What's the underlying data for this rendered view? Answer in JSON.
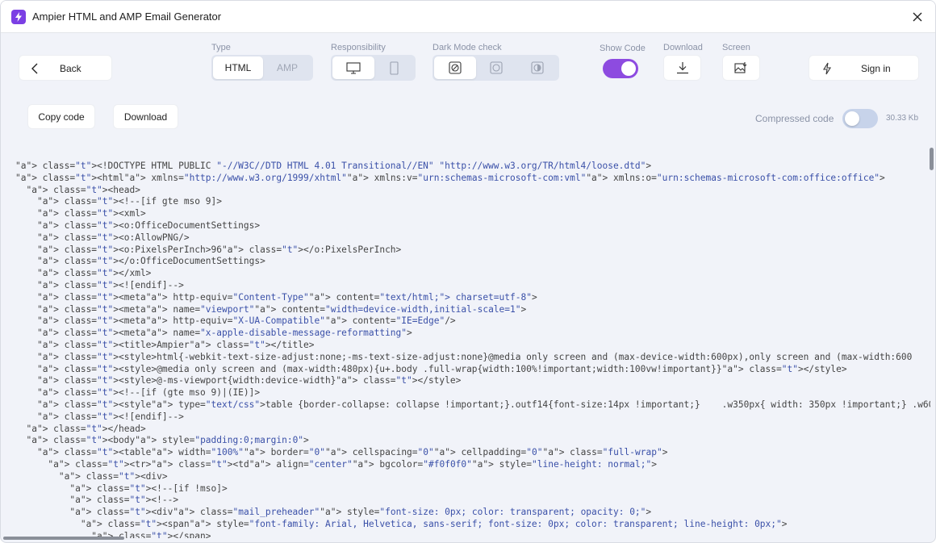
{
  "window": {
    "title": "Ampier HTML and AMP Email Generator"
  },
  "toolbar": {
    "back_label": "Back",
    "type": {
      "label": "Type",
      "options": [
        "HTML",
        "AMP"
      ],
      "selected": "HTML"
    },
    "responsibility": {
      "label": "Responsibility",
      "selected": "desktop"
    },
    "dark_mode": {
      "label": "Dark Mode check",
      "selected": "auto"
    },
    "show_code": {
      "label": "Show Code",
      "on": true
    },
    "download": {
      "label": "Download"
    },
    "screen": {
      "label": "Screen"
    },
    "sign_in_label": "Sign in"
  },
  "actions": {
    "copy_code_label": "Copy code",
    "download_label": "Download",
    "compressed_label": "Compressed code",
    "compressed_on": false,
    "size": "30.33 Kb"
  },
  "colors": {
    "accent": "#8d4be0",
    "tag": "#3a50a8",
    "background": "#f1f3f9"
  },
  "code": {
    "lines": [
      "<!DOCTYPE HTML PUBLIC \"-//W3C//DTD HTML 4.01 Transitional//EN\" \"http://www.w3.org/TR/html4/loose.dtd\">",
      "<html xmlns=\"http://www.w3.org/1999/xhtml\" xmlns:v=\"urn:schemas-microsoft-com:vml\" xmlns:o=\"urn:schemas-microsoft-com:office:office\">",
      "  <head>",
      "    <!--[if gte mso 9]>",
      "    <xml>",
      "    <o:OfficeDocumentSettings>",
      "    <o:AllowPNG/>",
      "    <o:PixelsPerInch>96</o:PixelsPerInch>",
      "    </o:OfficeDocumentSettings>",
      "    </xml>",
      "    <![endif]-->",
      "    <meta http-equiv=\"Content-Type\" content=\"text/html; charset=utf-8\">",
      "    <meta name=\"viewport\" content=\"width=device-width,initial-scale=1\">",
      "    <meta http-equiv=\"X-UA-Compatible\" content=\"IE=Edge\"/>",
      "    <meta name=\"x-apple-disable-message-reformatting\">",
      "    <title>Ampier</title>",
      "    <style>html{-webkit-text-size-adjust:none;-ms-text-size-adjust:none}@media only screen and (max-device-width:600px),only screen and (max-width:600",
      "    <style>@media only screen and (max-width:480px){u+.body .full-wrap{width:100%!important;width:100vw!important}}</style>",
      "    <style>@-ms-viewport{width:device-width}</style>",
      "    <!--[if (gte mso 9)|(IE)]>",
      "    <style type=\"text/css\">table {border-collapse: collapse !important;}.outf14{font-size:14px !important;}    .w350px{ width: 350px !important;} .w60",
      "    <![endif]-->",
      "  </head>",
      "  <body style=\"padding:0;margin:0\">",
      "    <table width=\"100%\" border=\"0\" cellspacing=\"0\" cellpadding=\"0\" class=\"full-wrap\">",
      "      <tr><td align=\"center\" bgcolor=\"#f0f0f0\" style=\"line-height: normal;\">",
      "        <div>",
      "          <!--[if !mso]>",
      "          <!-->",
      "          <div class=\"mail_preheader\" style=\"font-size: 0px; color: transparent; opacity: 0;\">",
      "            <span style=\"font-family: Arial, Helvetica, sans-serif; font-size: 0px; color: transparent; line-height: 0px;\">",
      "              </span>"
    ]
  }
}
